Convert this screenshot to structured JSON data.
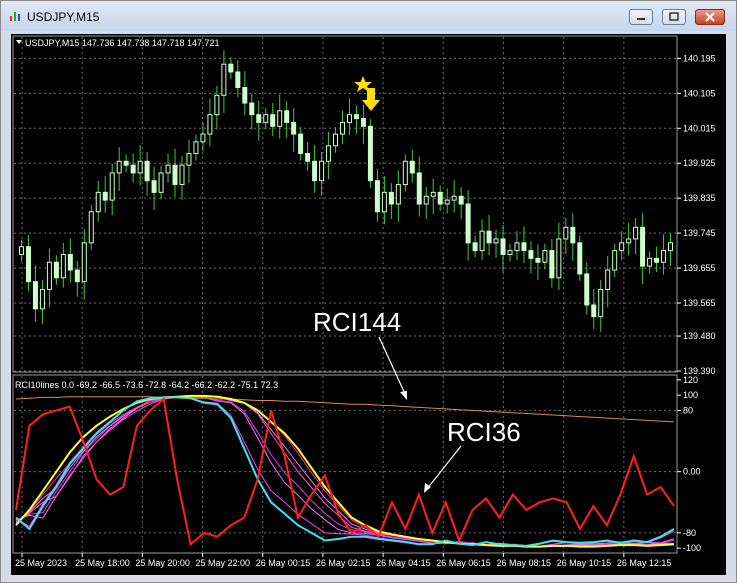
{
  "window": {
    "title": "USDJPY,M15",
    "controls": [
      "minimize",
      "maximize",
      "close"
    ]
  },
  "colors": {
    "background": "#000000",
    "grid": "#6f6f6f",
    "candle": "#ccffcc",
    "wick": "#3fc93f",
    "rci_fast": "#ff2020",
    "rci_slow": "#ffff30",
    "rci_cyan": "#40e0f0",
    "rci_mid": "#ff40ff",
    "rci_longest": "#d88a50",
    "signal": "#ffe000"
  },
  "chart_data": [
    {
      "type": "candlestick",
      "symbol_header": "USDJPY,M15  147.736 147.738 147.718 147.721",
      "ylim": [
        139.39,
        140.25
      ],
      "y_ticks": [
        "140.195",
        "140.105",
        "140.015",
        "139.925",
        "139.835",
        "139.745",
        "139.655",
        "139.565",
        "139.480",
        "139.390"
      ],
      "candles_close": [
        139.71,
        139.62,
        139.55,
        139.6,
        139.67,
        139.63,
        139.69,
        139.65,
        139.62,
        139.72,
        139.8,
        139.85,
        139.83,
        139.9,
        139.93,
        139.92,
        139.9,
        139.93,
        139.88,
        139.85,
        139.9,
        139.92,
        139.87,
        139.92,
        139.95,
        139.98,
        140.0,
        140.05,
        140.1,
        140.18,
        140.16,
        140.12,
        140.08,
        140.05,
        140.03,
        140.05,
        140.02,
        140.06,
        140.03,
        140.0,
        139.95,
        139.93,
        139.88,
        139.93,
        139.97,
        140.0,
        140.03,
        140.05,
        140.04,
        140.02,
        139.88,
        139.8,
        139.85,
        139.82,
        139.87,
        139.93,
        139.9,
        139.82,
        139.84,
        139.85,
        139.82,
        139.83,
        139.84,
        139.82,
        139.72,
        139.7,
        139.75,
        139.72,
        139.73,
        139.69,
        139.7,
        139.72,
        139.7,
        139.68,
        139.67,
        139.7,
        139.63,
        139.73,
        139.76,
        139.72,
        139.64,
        139.56,
        139.53,
        139.6,
        139.65,
        139.7,
        139.72,
        139.73,
        139.76,
        139.66,
        139.68,
        139.67,
        139.7,
        139.72
      ]
    },
    {
      "type": "line",
      "indicator_header": "RCI10lines 0.0 -69.2 -66.5 -73.6 -72.8 -64.2 -66.2 -62.2 -75.1 72.3",
      "ylim": [
        -105,
        125
      ],
      "y_ticks": [
        "120",
        "100",
        "80",
        "0.00",
        "-80",
        "-100"
      ],
      "x_ticks": [
        "25 May 2023",
        "25 May 18:00",
        "25 May 20:00",
        "25 May 22:00",
        "26 May 00:15",
        "26 May 02:15",
        "26 May 04:15",
        "26 May 06:15",
        "26 May 08:15",
        "26 May 10:15",
        "26 May 12:15"
      ],
      "series": [
        {
          "name": "RCI36",
          "role": "fast",
          "values": [
            -50,
            60,
            75,
            80,
            85,
            40,
            -10,
            -30,
            -20,
            60,
            80,
            95,
            -10,
            -95,
            -80,
            -85,
            -70,
            -60,
            -10,
            80,
            20,
            -60,
            -30,
            -5,
            -55,
            -80,
            -70,
            -85,
            -40,
            -75,
            -30,
            -80,
            -40,
            -90,
            -50,
            -35,
            -60,
            -30,
            -50,
            -40,
            -35,
            -40,
            -75,
            -45,
            -70,
            -30,
            20,
            -30,
            -20,
            -45
          ]
        },
        {
          "name": "",
          "role": "cyan",
          "values": [
            -60,
            -75,
            -45,
            -20,
            10,
            30,
            50,
            65,
            80,
            92,
            96,
            97,
            97,
            96,
            90,
            88,
            70,
            30,
            -10,
            -40,
            -55,
            -70,
            -80,
            -90,
            -88,
            -85,
            -85,
            -88,
            -90,
            -92,
            -95,
            -95,
            -90,
            -94,
            -96,
            -92,
            -95,
            -96,
            -97,
            -94,
            -90,
            -92,
            -93,
            -92,
            -90,
            -93,
            -90,
            -92,
            -85,
            -75
          ]
        },
        {
          "name": "",
          "role": "slow",
          "values": [
            -70,
            -50,
            -25,
            0,
            25,
            45,
            60,
            72,
            82,
            90,
            95,
            97,
            98,
            99,
            99,
            98,
            95,
            90,
            80,
            65,
            50,
            30,
            5,
            -20,
            -40,
            -60,
            -70,
            -78,
            -82,
            -85,
            -88,
            -90,
            -92,
            -94,
            -95,
            -96,
            -97,
            -97,
            -98,
            -98,
            -97,
            -97,
            -98,
            -98,
            -97,
            -96,
            -96,
            -97,
            -96,
            -95
          ]
        },
        {
          "name": "RCI144",
          "role": "longest",
          "values": [
            95,
            96,
            97,
            97,
            98,
            98,
            98,
            98,
            98,
            98,
            98,
            97,
            97,
            96,
            96,
            95,
            95,
            94,
            93,
            93,
            92,
            92,
            91,
            90,
            89,
            88,
            88,
            87,
            86,
            85,
            84,
            83,
            82,
            81,
            80,
            79,
            78,
            77,
            76,
            75,
            74,
            73,
            72,
            71,
            70,
            69,
            68,
            67,
            66,
            65
          ]
        }
      ],
      "annotations": [
        "RCI144",
        "RCI36"
      ]
    }
  ]
}
